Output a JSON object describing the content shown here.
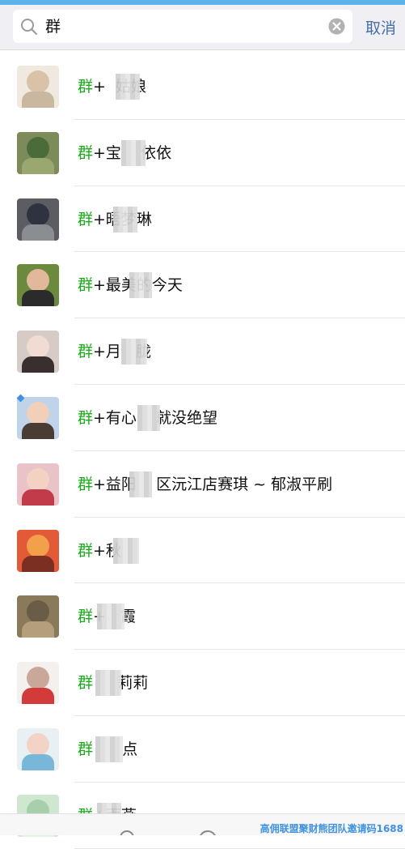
{
  "search": {
    "query": "群",
    "cancel_label": "取消",
    "icon": "search-icon",
    "clear_icon": "clear-icon"
  },
  "results": [
    {
      "keyword": "群",
      "rest": "+  姑娘",
      "colors": [
        "#efe9df",
        "#d9c2a8",
        "#c9b79f"
      ]
    },
    {
      "keyword": "群",
      "rest": "+宝    依依",
      "colors": [
        "#7d8a5a",
        "#4c6b3a",
        "#9aa870"
      ]
    },
    {
      "keyword": "群",
      "rest": "+晤梦琳",
      "colors": [
        "#5b5d63",
        "#2f3340",
        "#8a8d92"
      ]
    },
    {
      "keyword": "群",
      "rest": "+最美的今天",
      "colors": [
        "#6b8a3e",
        "#e2b89c",
        "#2b2b2b"
      ]
    },
    {
      "keyword": "群",
      "rest": "+月   胧",
      "colors": [
        "#d6cbc7",
        "#f0dcd2",
        "#3a2f2f"
      ]
    },
    {
      "keyword": "群",
      "rest": "+有心    就没绝望",
      "colors": [
        "#bfd4ea",
        "#f2cfb8",
        "#4a3b34"
      ]
    },
    {
      "keyword": "群",
      "rest": "+益阳    区沅江店赛琪 ~ 郁淑平刷",
      "colors": [
        "#e9c3c8",
        "#f3d2c3",
        "#c23b4b"
      ]
    },
    {
      "keyword": "群",
      "rest": "+秋   ",
      "colors": [
        "#e35a38",
        "#f2a04a",
        "#7b2f23"
      ]
    },
    {
      "keyword": "群",
      "rest": "+   霞",
      "colors": [
        "#8a7a5a",
        "#6a5c46",
        "#b49f7c"
      ]
    },
    {
      "keyword": "群",
      "rest": "     莉莉",
      "colors": [
        "#f4f0ee",
        "#c9a89a",
        "#d33a3a"
      ]
    },
    {
      "keyword": "群",
      "rest": "      点",
      "colors": [
        "#e9f0f4",
        "#f2d3c5",
        "#79b7d8"
      ]
    },
    {
      "keyword": "群",
      "rest": "+雨燕",
      "colors": [
        "#cfe6d0",
        "#a7cfa9",
        "#e7f0e4"
      ]
    }
  ],
  "watermark": "高佣联盟聚财熊团队邀请码1688"
}
